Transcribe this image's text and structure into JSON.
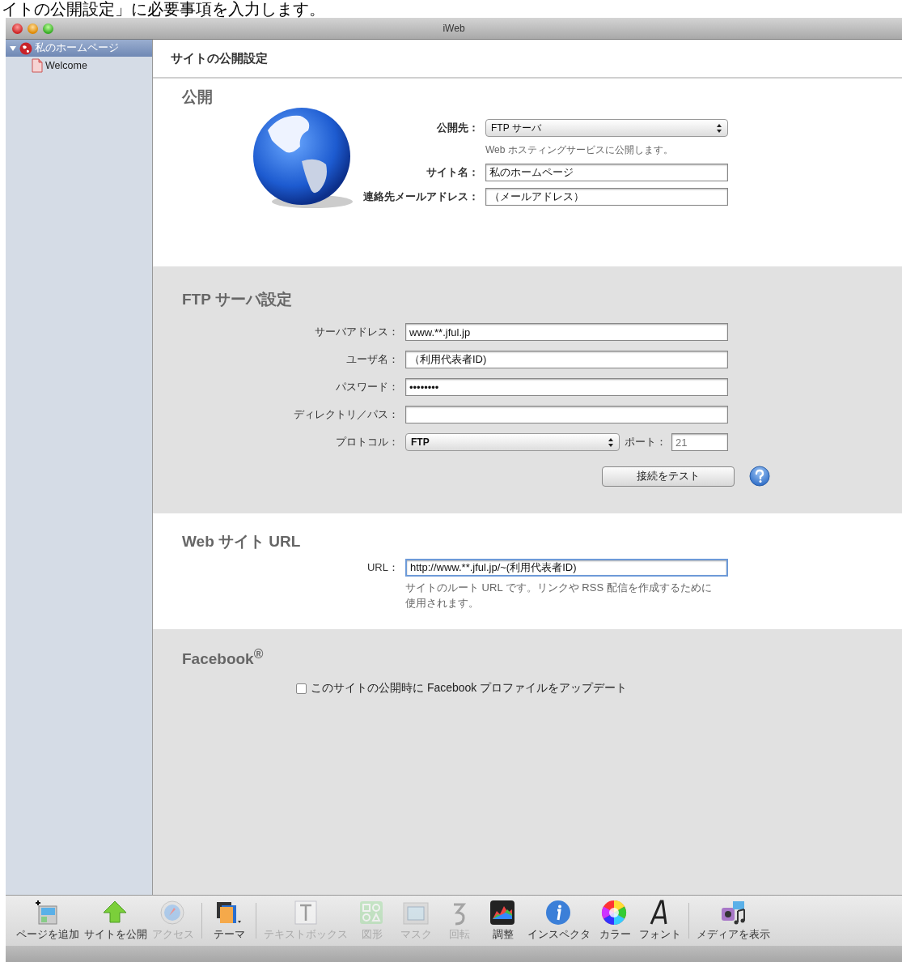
{
  "caption": "イトの公開設定」に必要事項を入力します。",
  "window": {
    "title": "iWeb"
  },
  "sidebar": {
    "items": [
      {
        "label": "私のホームページ",
        "selected": true,
        "expanded": true,
        "children": [
          {
            "label": "Welcome",
            "selected": false
          }
        ]
      }
    ]
  },
  "header": {
    "title": "サイトの公開設定"
  },
  "publish": {
    "heading": "公開",
    "destination": {
      "label": "公開先：",
      "value": "FTP サーバ"
    },
    "destination_note": "Web ホスティングサービスに公開します。",
    "fields": [
      {
        "label": "サイト名：",
        "value": "私のホームページ"
      },
      {
        "label": "連絡先メールアドレス：",
        "value": "（メールアドレス）"
      }
    ]
  },
  "ftp": {
    "heading": "FTP サーバ設定",
    "fields": [
      {
        "label": "サーバアドレス：",
        "value": "www.**.jful.jp"
      },
      {
        "label": "ユーザ名：",
        "value": "（利用代表者ID)"
      },
      {
        "label": "パスワード：",
        "value": "••••••••"
      },
      {
        "label": "ディレクトリ／パス："
      }
    ],
    "protocol": {
      "label": "プロトコル：",
      "value": "FTP"
    },
    "port": {
      "label": "ポート：",
      "placeholder": "21"
    },
    "test_button": "接続をテスト"
  },
  "site_url": {
    "heading": "Web サイト URL",
    "field": {
      "label": "URL：",
      "value": "http://www.**.jful.jp/~(利用代表者ID)",
      "focused": true
    },
    "note": "サイトのルート URL です。リンクや RSS 配信を作成するために使用されます。"
  },
  "facebook": {
    "heading": "Facebook$^{®}$",
    "checkbox": {
      "label": "このサイトの公開時に Facebook プロファイルをアップデート",
      "checked": false
    }
  },
  "toolbar": {
    "groups": [
      {
        "items": [
          {
            "label": "ページを追加",
            "disabled": false
          },
          {
            "label": "サイトを公開",
            "disabled": false
          },
          {
            "label": "アクセス",
            "disabled": true
          }
        ]
      },
      {
        "items": [
          {
            "label": "テーマ",
            "disabled": false
          }
        ]
      },
      {
        "items": [
          {
            "label": "テキストボックス",
            "disabled": true
          },
          {
            "label": "図形",
            "disabled": true
          },
          {
            "label": "マスク",
            "disabled": true
          },
          {
            "label": "回転",
            "disabled": true
          },
          {
            "label": "調整",
            "disabled": false
          },
          {
            "label": "インスペクタ",
            "disabled": false
          },
          {
            "label": "カラー",
            "disabled": false
          },
          {
            "label": "フォント",
            "disabled": false
          }
        ]
      },
      {
        "items": [
          {
            "label": "メディアを表示",
            "disabled": false
          }
        ]
      }
    ]
  }
}
